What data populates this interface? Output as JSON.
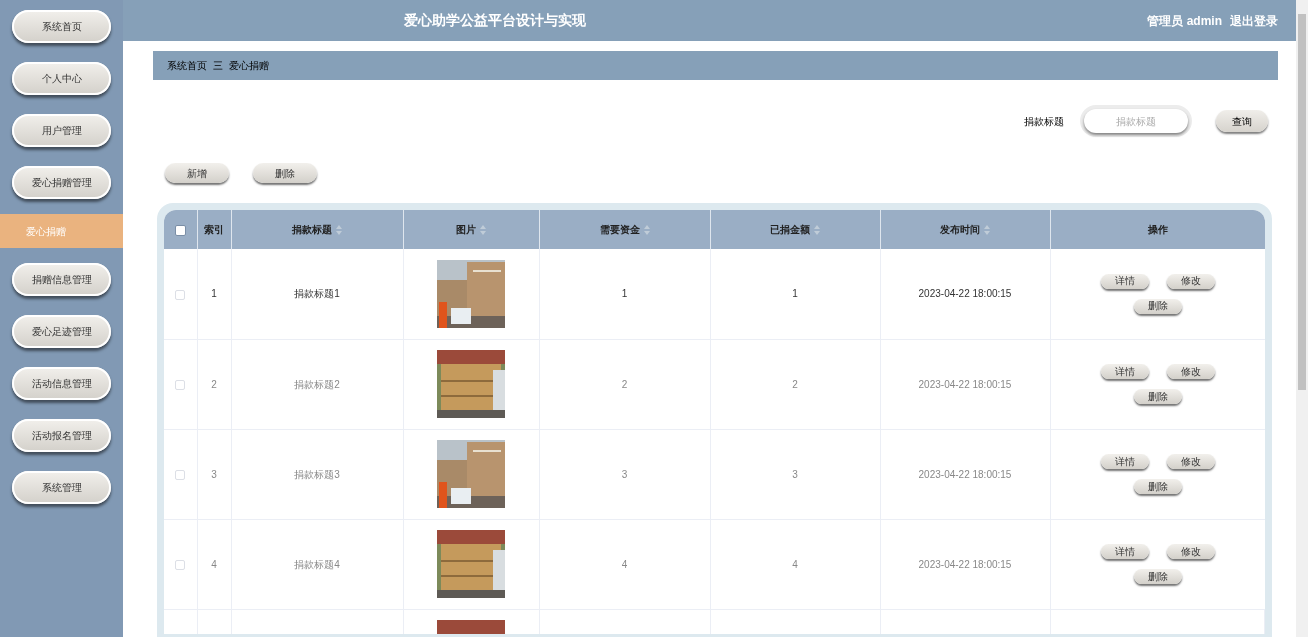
{
  "header": {
    "title": "爱心助学公益平台设计与实现",
    "user": "管理员 admin",
    "logout": "退出登录"
  },
  "sidebar": {
    "items": [
      {
        "label": "系统首页",
        "selected": false
      },
      {
        "label": "个人中心",
        "selected": false
      },
      {
        "label": "用户管理",
        "selected": false
      },
      {
        "label": "爱心捐赠管理",
        "selected": false
      },
      {
        "label": "爱心捐赠",
        "selected": true
      },
      {
        "label": "捐赠信息管理",
        "selected": false
      },
      {
        "label": "爱心足迹管理",
        "selected": false
      },
      {
        "label": "活动信息管理",
        "selected": false
      },
      {
        "label": "活动报名管理",
        "selected": false
      },
      {
        "label": "系统管理",
        "selected": false
      }
    ]
  },
  "breadcrumb": {
    "home": "系统首页",
    "separator": "三",
    "current": "爱心捐赠"
  },
  "search": {
    "label": "捐款标题",
    "placeholder": "捐款标题",
    "button": "查询"
  },
  "actions": [
    "新增",
    "删除"
  ],
  "table": {
    "select_all": false,
    "columns": [
      {
        "label": "索引",
        "sortable": false
      },
      {
        "label": "捐款标题",
        "sortable": true
      },
      {
        "label": "图片",
        "sortable": true
      },
      {
        "label": "需要资金",
        "sortable": true
      },
      {
        "label": "已捐金额",
        "sortable": true
      },
      {
        "label": "发布时间",
        "sortable": true
      },
      {
        "label": "操作",
        "sortable": false
      }
    ],
    "rows": [
      {
        "kind": "full",
        "checked": false,
        "highlighted": true,
        "index": "1",
        "title": "捐款标题1",
        "need": "1",
        "donated": "1",
        "time": "2023-04-22 18:00:15",
        "buttons": [
          "详情",
          "修改",
          "删除"
        ]
      },
      {
        "kind": "full",
        "checked": false,
        "highlighted": false,
        "index": "2",
        "title": "捐款标题2",
        "need": "2",
        "donated": "2",
        "time": "2023-04-22 18:00:15",
        "buttons": [
          "详情",
          "修改",
          "删除"
        ]
      },
      {
        "kind": "full",
        "checked": false,
        "highlighted": false,
        "index": "3",
        "title": "捐款标题3",
        "need": "3",
        "donated": "3",
        "time": "2023-04-22 18:00:15",
        "buttons": [
          "详情",
          "修改",
          "删除"
        ]
      },
      {
        "kind": "full",
        "checked": false,
        "highlighted": false,
        "index": "4",
        "title": "捐款标题4",
        "need": "4",
        "donated": "4",
        "time": "2023-04-22 18:00:15",
        "buttons": [
          "详情",
          "修改",
          "删除"
        ]
      },
      {
        "kind": "partial"
      }
    ]
  }
}
